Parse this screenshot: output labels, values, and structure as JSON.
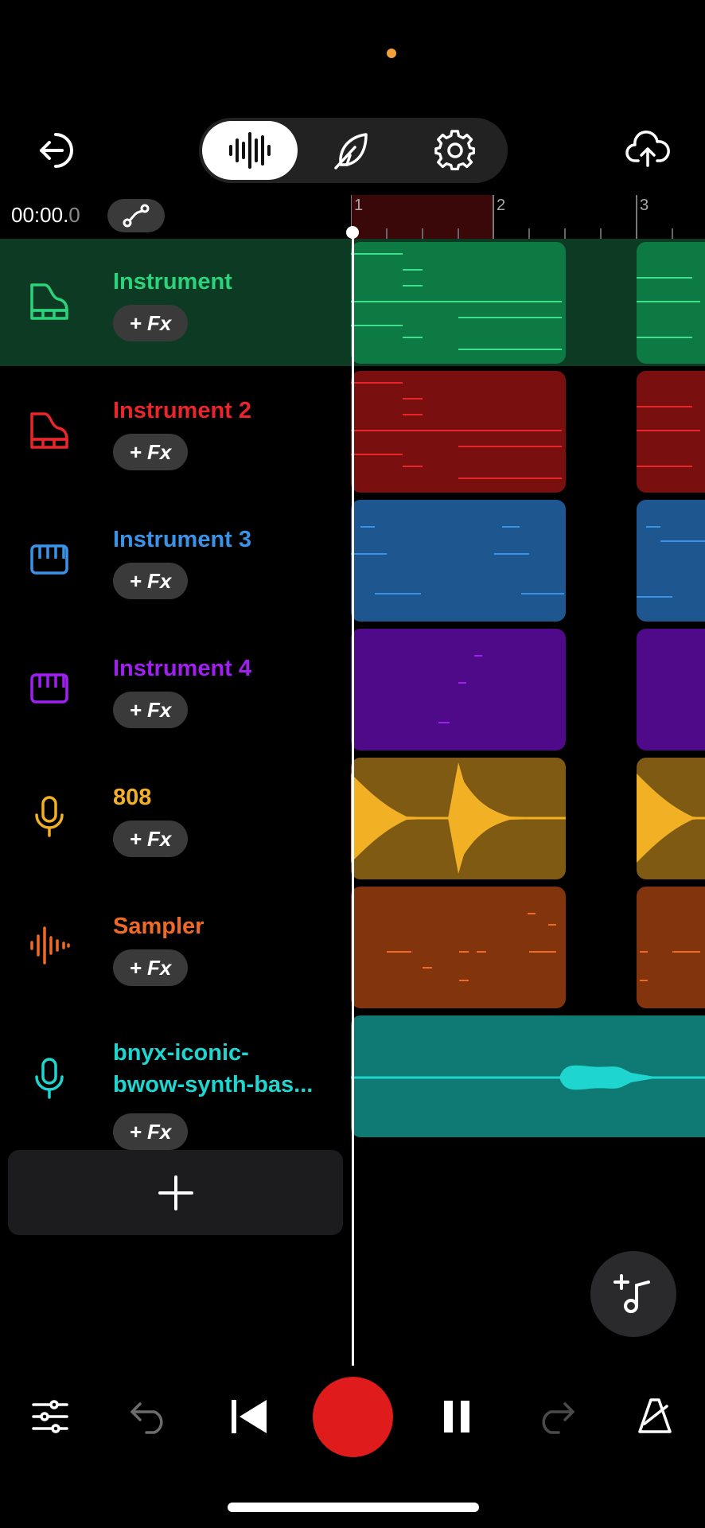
{
  "header": {
    "exit_icon": "exit-arrow-icon",
    "modes": [
      {
        "icon": "waveform-icon",
        "active": true
      },
      {
        "icon": "feather-icon",
        "active": false
      },
      {
        "icon": "gear-icon",
        "active": false
      }
    ],
    "upload_icon": "cloud-upload-icon"
  },
  "timeline": {
    "time_main": "00:00.",
    "time_fraction": "0",
    "bars": [
      "1",
      "2",
      "3"
    ]
  },
  "tracks": [
    {
      "name": "Instrument",
      "fx_label": "+ Fx",
      "color": "#2bd37c",
      "clip_color": "#0e7a43",
      "note_color": "#3ee08c",
      "icon": "piano-icon",
      "selected": true
    },
    {
      "name": "Instrument 2",
      "fx_label": "+ Fx",
      "color": "#e8262b",
      "clip_color": "#7a0f10",
      "note_color": "#e8262b",
      "icon": "piano-icon",
      "selected": false
    },
    {
      "name": "Instrument 3",
      "fx_label": "+ Fx",
      "color": "#3b93e8",
      "clip_color": "#1e5690",
      "note_color": "#3b93e8",
      "icon": "drum-machine-icon",
      "selected": false
    },
    {
      "name": "Instrument 4",
      "fx_label": "+ Fx",
      "color": "#a020f0",
      "clip_color": "#4f0a8a",
      "note_color": "#a020f0",
      "icon": "drum-machine-icon",
      "selected": false
    },
    {
      "name": "808",
      "fx_label": "+ Fx",
      "color": "#f2b024",
      "clip_color": "#7e5a12",
      "note_color": "#f2b024",
      "icon": "microphone-icon",
      "selected": false
    },
    {
      "name": "Sampler",
      "fx_label": "+ Fx",
      "color": "#f06a25",
      "clip_color": "#82340c",
      "note_color": "#f06a25",
      "icon": "sampler-icon",
      "selected": false
    },
    {
      "name_line1": "bnyx-iconic-",
      "name_line2": "bwow-synth-bas...",
      "fx_label": "+ Fx",
      "color": "#1ed6cf",
      "clip_color": "#0f7a73",
      "note_color": "#1ed6cf",
      "icon": "microphone-icon",
      "selected": false
    }
  ],
  "add_track_icon": "plus-icon",
  "add_note_icon": "add-note-icon",
  "transport": {
    "items": [
      "mixer-icon",
      "undo-icon",
      "skip-back-icon",
      "record-button",
      "pause-icon",
      "redo-icon",
      "metronome-icon"
    ]
  }
}
